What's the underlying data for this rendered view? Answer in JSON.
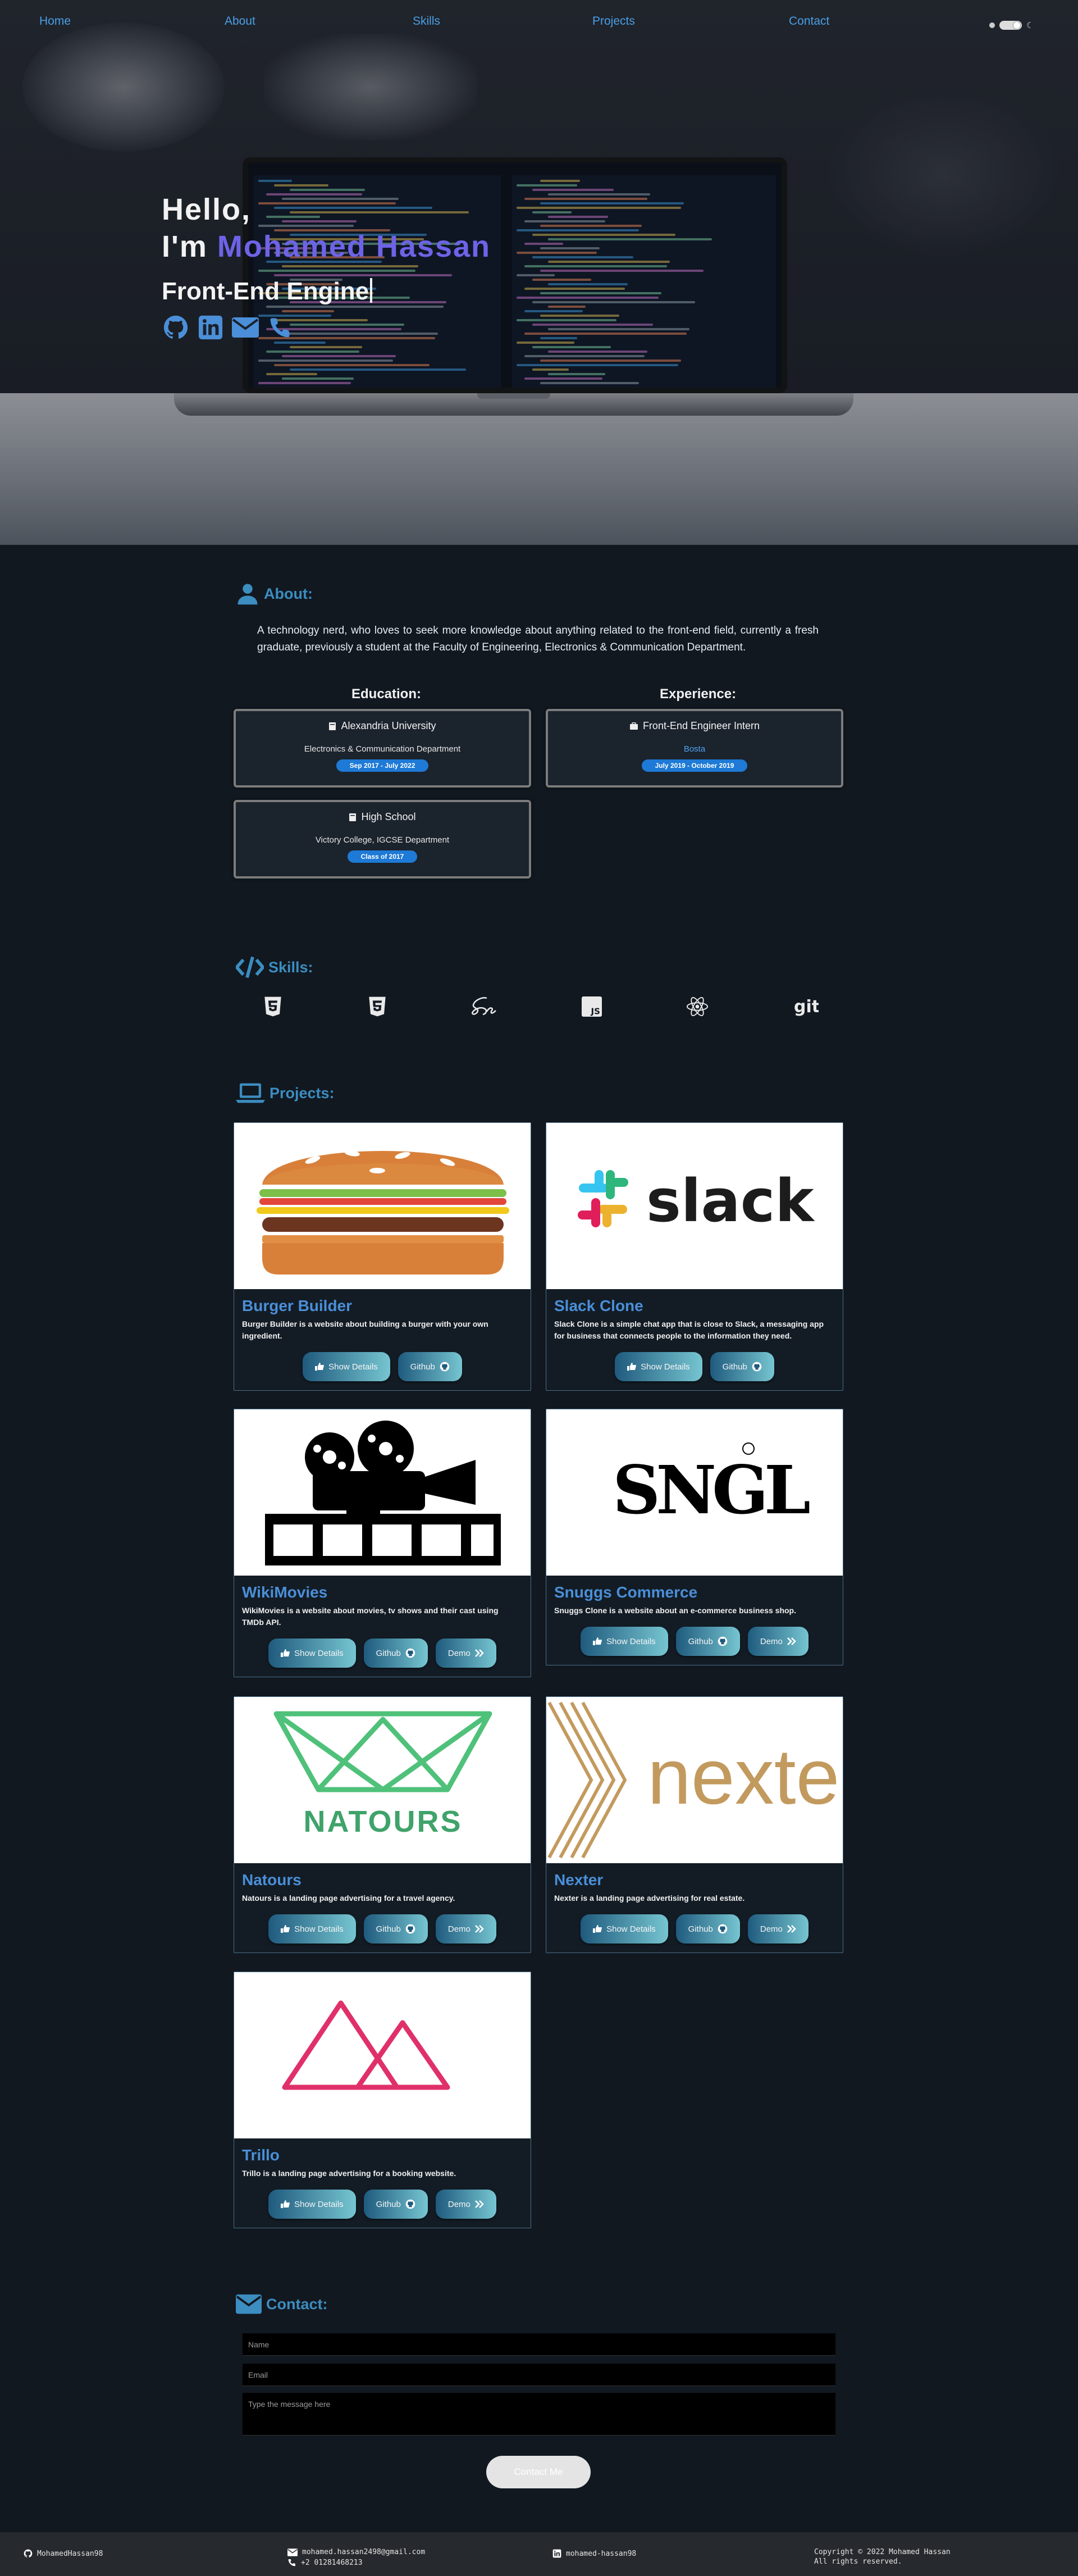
{
  "nav": {
    "items": [
      "Home",
      "About",
      "Skills",
      "Projects",
      "Contact"
    ]
  },
  "theme_toggle": {
    "moon": "☾"
  },
  "hero": {
    "greeting": "Hello,",
    "im": "I'm",
    "name": "Mohamed Hassan",
    "role": "Front-End Engine",
    "socials": [
      "github-icon",
      "linkedin-icon",
      "mail-icon",
      "phone-icon"
    ]
  },
  "about": {
    "title": "About:",
    "text": "A technology nerd, who loves to seek more knowledge about anything related to the front-end field, currently a fresh graduate, previously a student at the Faculty of Engineering, Electronics & Communication Department.",
    "education_title": "Education:",
    "experience_title": "Experience:",
    "education": [
      {
        "title": "Alexandria University",
        "subtitle": "Electronics & Communication Department",
        "date": "Sep 2017 - July 2022"
      },
      {
        "title": "High School",
        "subtitle": "Victory College, IGCSE Department",
        "date": "Class of 2017"
      }
    ],
    "experience": [
      {
        "title": "Front-End Engineer Intern",
        "subtitle": "Bosta",
        "date": "July 2019 - October 2019"
      }
    ]
  },
  "skills": {
    "title": "Skills:",
    "items": [
      "html5-icon",
      "css3-icon",
      "sass-icon",
      "javascript-icon",
      "react-icon",
      "git-icon"
    ]
  },
  "projects": {
    "title": "Projects:",
    "items": [
      {
        "title": "Burger Builder",
        "desc": "Burger Builder is a website about building a burger with your own ingredient.",
        "buttons": [
          "Show Details",
          "Github"
        ]
      },
      {
        "title": "Slack Clone",
        "desc": "Slack Clone is a simple chat app that is close to Slack, a messaging app for business that connects people to the information they need.",
        "buttons": [
          "Show Details",
          "Github"
        ],
        "logo_text": "slack"
      },
      {
        "title": "WikiMovies",
        "desc": "WikiMovies is a website about movies, tv shows and their cast using TMDb API.",
        "buttons": [
          "Show Details",
          "Github",
          "Demo"
        ]
      },
      {
        "title": "Snuggs Commerce",
        "desc": "Snuggs Clone is a website about an e-commerce business shop.",
        "buttons": [
          "Show Details",
          "Github",
          "Demo"
        ],
        "logo_text": "SNGL"
      },
      {
        "title": "Natours",
        "desc": "Natours is a landing page advertising for a travel agency.",
        "buttons": [
          "Show Details",
          "Github",
          "Demo"
        ],
        "logo_text": "NATOURS"
      },
      {
        "title": "Nexter",
        "desc": "Nexter is a landing page advertising for real estate.",
        "buttons": [
          "Show Details",
          "Github",
          "Demo"
        ],
        "logo_text": "nexter"
      },
      {
        "title": "Trillo",
        "desc": "Trillo is a landing page advertising for a booking website.",
        "buttons": [
          "Show Details",
          "Github",
          "Demo"
        ]
      }
    ]
  },
  "contact": {
    "title": "Contact:",
    "name_placeholder": "Name",
    "email_placeholder": "Email",
    "message_placeholder": "Type the message here",
    "send_label": "Contact Me"
  },
  "footer": {
    "github": "MohamedHassan98",
    "email": "mohamed.hassan2498@gmail.com",
    "phone": "+2 01281468213",
    "linkedin": "mohamed-hassan98",
    "copyright": "Copyright © 2022 Mohamed Hassan",
    "rights": "All rights reserved."
  },
  "colors": {
    "accent": "#3c8dc0",
    "link": "#4a9fe6",
    "name": "#6e63e8",
    "pill": "#1e7ad6"
  }
}
